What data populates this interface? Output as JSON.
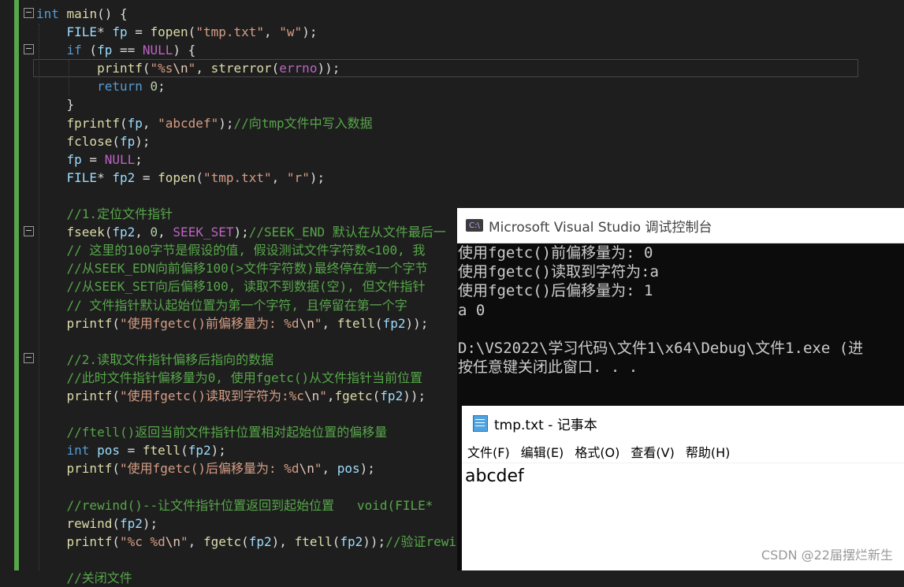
{
  "editor": {
    "lines": [
      [
        {
          "t": "int",
          "c": "kw"
        },
        {
          "t": " "
        },
        {
          "t": "main",
          "c": "fn"
        },
        {
          "t": "() {"
        }
      ],
      [
        {
          "t": "    FILE",
          "c": "var"
        },
        {
          "t": "* "
        },
        {
          "t": "fp",
          "c": "var"
        },
        {
          "t": " = "
        },
        {
          "t": "fopen",
          "c": "fn"
        },
        {
          "t": "("
        },
        {
          "t": "\"tmp.txt\"",
          "c": "str"
        },
        {
          "t": ", "
        },
        {
          "t": "\"w\"",
          "c": "str"
        },
        {
          "t": ");"
        }
      ],
      [
        {
          "t": "    if",
          "c": "kw"
        },
        {
          "t": " ("
        },
        {
          "t": "fp",
          "c": "var"
        },
        {
          "t": " == "
        },
        {
          "t": "NULL",
          "c": "mac"
        },
        {
          "t": ") {"
        }
      ],
      [
        {
          "t": "        "
        },
        {
          "t": "printf",
          "c": "fn"
        },
        {
          "t": "("
        },
        {
          "t": "\"%s",
          "c": "str"
        },
        {
          "t": "\\n",
          "c": "esc"
        },
        {
          "t": "\"",
          "c": "str"
        },
        {
          "t": ", "
        },
        {
          "t": "strerror",
          "c": "fn"
        },
        {
          "t": "("
        },
        {
          "t": "errno",
          "c": "mac"
        },
        {
          "t": "));"
        }
      ],
      [
        {
          "t": "        return",
          "c": "kw"
        },
        {
          "t": " "
        },
        {
          "t": "0",
          "c": "num"
        },
        {
          "t": ";"
        }
      ],
      [
        {
          "t": "    }"
        }
      ],
      [
        {
          "t": "    "
        },
        {
          "t": "fprintf",
          "c": "fn"
        },
        {
          "t": "("
        },
        {
          "t": "fp",
          "c": "var"
        },
        {
          "t": ", "
        },
        {
          "t": "\"abcdef\"",
          "c": "str"
        },
        {
          "t": ");"
        },
        {
          "t": "//向tmp文件中写入数据",
          "c": "cm"
        }
      ],
      [
        {
          "t": "    "
        },
        {
          "t": "fclose",
          "c": "fn"
        },
        {
          "t": "("
        },
        {
          "t": "fp",
          "c": "var"
        },
        {
          "t": ");"
        }
      ],
      [
        {
          "t": "    fp",
          "c": "var"
        },
        {
          "t": " = "
        },
        {
          "t": "NULL",
          "c": "mac"
        },
        {
          "t": ";"
        }
      ],
      [
        {
          "t": "    FILE",
          "c": "var"
        },
        {
          "t": "* "
        },
        {
          "t": "fp2",
          "c": "var"
        },
        {
          "t": " = "
        },
        {
          "t": "fopen",
          "c": "fn"
        },
        {
          "t": "("
        },
        {
          "t": "\"tmp.txt\"",
          "c": "str"
        },
        {
          "t": ", "
        },
        {
          "t": "\"r\"",
          "c": "str"
        },
        {
          "t": ");"
        }
      ],
      [
        {
          "t": ""
        }
      ],
      [
        {
          "t": "    //1.定位文件指针",
          "c": "cm"
        }
      ],
      [
        {
          "t": "    "
        },
        {
          "t": "fseek",
          "c": "fn"
        },
        {
          "t": "("
        },
        {
          "t": "fp2",
          "c": "var"
        },
        {
          "t": ", "
        },
        {
          "t": "0",
          "c": "num"
        },
        {
          "t": ", "
        },
        {
          "t": "SEEK_SET",
          "c": "mac"
        },
        {
          "t": ");"
        },
        {
          "t": "//SEEK_END 默认在从文件最后一",
          "c": "cm"
        }
      ],
      [
        {
          "t": "    // 这里的100字节是假设的值, 假设测试文件字符数<100, 我",
          "c": "cm"
        }
      ],
      [
        {
          "t": "    //从SEEK_EDN向前偏移100(>文件字符数)最终停在第一个字节",
          "c": "cm"
        }
      ],
      [
        {
          "t": "    //从SEEK_SET向后偏移100, 读取不到数据(空), 但文件指针",
          "c": "cm"
        }
      ],
      [
        {
          "t": "    // 文件指针默认起始位置为第一个字符, 且停留在第一个字",
          "c": "cm"
        }
      ],
      [
        {
          "t": "    "
        },
        {
          "t": "printf",
          "c": "fn"
        },
        {
          "t": "("
        },
        {
          "t": "\"使用fgetc()前偏移量为: %d",
          "c": "str"
        },
        {
          "t": "\\n",
          "c": "esc"
        },
        {
          "t": "\"",
          "c": "str"
        },
        {
          "t": ", "
        },
        {
          "t": "ftell",
          "c": "fn"
        },
        {
          "t": "("
        },
        {
          "t": "fp2",
          "c": "var"
        },
        {
          "t": "));"
        }
      ],
      [
        {
          "t": ""
        }
      ],
      [
        {
          "t": "    //2.读取文件指针偏移后指向的数据",
          "c": "cm"
        }
      ],
      [
        {
          "t": "    //此时文件指针偏移量为0, 使用fgetc()从文件指针当前位置",
          "c": "cm"
        }
      ],
      [
        {
          "t": "    "
        },
        {
          "t": "printf",
          "c": "fn"
        },
        {
          "t": "("
        },
        {
          "t": "\"使用fgetc()读取到字符为:%c",
          "c": "str"
        },
        {
          "t": "\\n",
          "c": "esc"
        },
        {
          "t": "\"",
          "c": "str"
        },
        {
          "t": ","
        },
        {
          "t": "fgetc",
          "c": "fn"
        },
        {
          "t": "("
        },
        {
          "t": "fp2",
          "c": "var"
        },
        {
          "t": "));"
        }
      ],
      [
        {
          "t": ""
        }
      ],
      [
        {
          "t": "    //ftell()返回当前文件指针位置相对起始位置的偏移量",
          "c": "cm"
        }
      ],
      [
        {
          "t": "    int",
          "c": "kw"
        },
        {
          "t": " "
        },
        {
          "t": "pos",
          "c": "var"
        },
        {
          "t": " = "
        },
        {
          "t": "ftell",
          "c": "fn"
        },
        {
          "t": "("
        },
        {
          "t": "fp2",
          "c": "var"
        },
        {
          "t": ");"
        }
      ],
      [
        {
          "t": "    "
        },
        {
          "t": "printf",
          "c": "fn"
        },
        {
          "t": "("
        },
        {
          "t": "\"使用fgetc()后偏移量为: %d",
          "c": "str"
        },
        {
          "t": "\\n",
          "c": "esc"
        },
        {
          "t": "\"",
          "c": "str"
        },
        {
          "t": ", "
        },
        {
          "t": "pos",
          "c": "var"
        },
        {
          "t": ");"
        }
      ],
      [
        {
          "t": ""
        }
      ],
      [
        {
          "t": "    //rewind()--让文件指针位置返回到起始位置   void(FILE*",
          "c": "cm"
        }
      ],
      [
        {
          "t": "    "
        },
        {
          "t": "rewind",
          "c": "fn"
        },
        {
          "t": "("
        },
        {
          "t": "fp2",
          "c": "var"
        },
        {
          "t": ");"
        }
      ],
      [
        {
          "t": "    "
        },
        {
          "t": "printf",
          "c": "fn"
        },
        {
          "t": "("
        },
        {
          "t": "\"%c %d",
          "c": "str"
        },
        {
          "t": "\\n",
          "c": "esc"
        },
        {
          "t": "\"",
          "c": "str"
        },
        {
          "t": ", "
        },
        {
          "t": "fgetc",
          "c": "fn"
        },
        {
          "t": "("
        },
        {
          "t": "fp2",
          "c": "var"
        },
        {
          "t": "), "
        },
        {
          "t": "ftell",
          "c": "fn"
        },
        {
          "t": "("
        },
        {
          "t": "fp2",
          "c": "var"
        },
        {
          "t": "));"
        },
        {
          "t": "//验证rewin",
          "c": "cm"
        }
      ],
      [
        {
          "t": ""
        }
      ],
      [
        {
          "t": "    //关闭文件",
          "c": "cm"
        }
      ]
    ]
  },
  "console": {
    "title": "Microsoft Visual Studio 调试控制台",
    "icon": "vs-icon",
    "icon_text": "C:\\",
    "output": "使用fgetc()前偏移量为: 0\n使用fgetc()读取到字符为:a\n使用fgetc()后偏移量为: 1\na 0\n\nD:\\VS2022\\学习代码\\文件1\\x64\\Debug\\文件1.exe (进\n按任意键关闭此窗口. . ."
  },
  "notepad": {
    "title": "tmp.txt - 记事本",
    "menu": [
      "文件(F)",
      "编辑(E)",
      "格式(O)",
      "查看(V)",
      "帮助(H)"
    ],
    "content": "abcdef"
  },
  "watermark": "CSDN @22届摆烂新生"
}
